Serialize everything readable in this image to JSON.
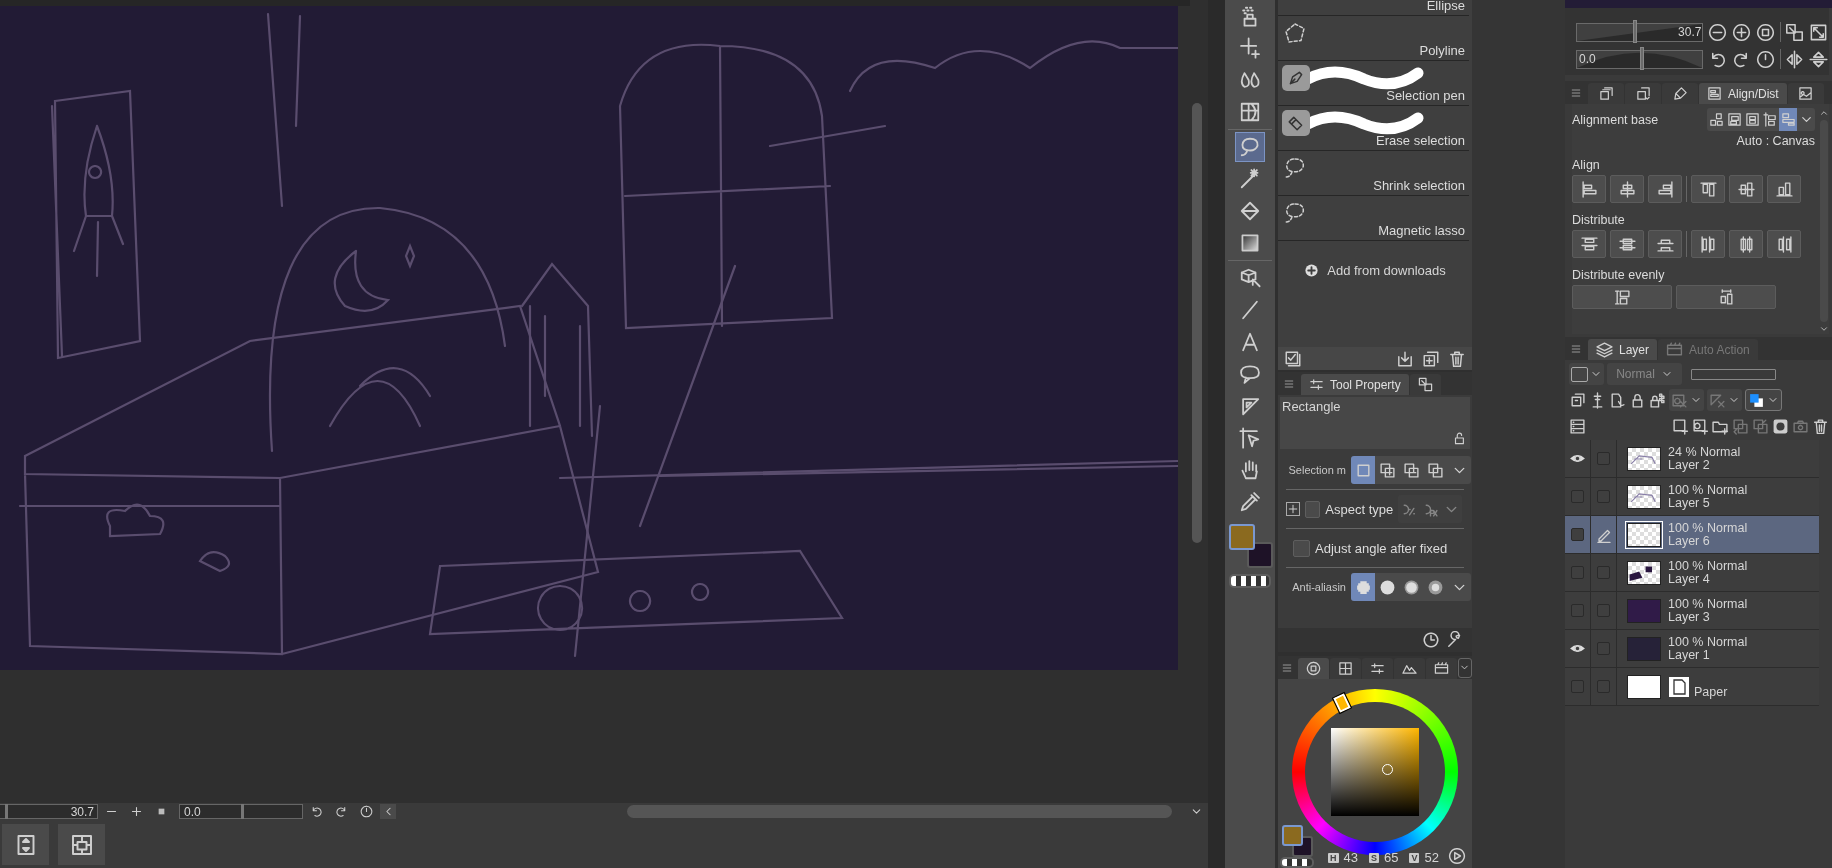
{
  "canvas": {
    "zoom_slider": {
      "value": "30.7",
      "level": 0.05
    },
    "rotation_slider": {
      "value": "0.0",
      "level": 0.5
    }
  },
  "tools": [
    {
      "selected": false
    },
    {
      "selected": false
    },
    {
      "selected": false
    },
    {
      "selected": false
    },
    {
      "selected": true
    },
    {
      "selected": false
    },
    {
      "selected": false
    },
    {
      "selected": false
    },
    {
      "selected": false
    },
    {
      "selected": false
    },
    {
      "selected": false
    },
    {
      "selected": false
    },
    {
      "selected": false
    },
    {
      "selected": false
    },
    {
      "selected": false
    },
    {
      "selected": false
    }
  ],
  "color_swatches": [
    {
      "color": "#8b6a1f",
      "selected": true
    },
    {
      "color": "#1e1227",
      "selected": false
    }
  ],
  "subtools": {
    "items": [
      {
        "name": "Ellipse",
        "kind": "ellipse",
        "selected": false
      },
      {
        "name": "Polyline",
        "kind": "polyline",
        "selected": false
      },
      {
        "name": "Selection pen",
        "kind": "pen",
        "selected": false
      },
      {
        "name": "Erase selection",
        "kind": "eraser",
        "selected": false
      },
      {
        "name": "Shrink selection",
        "kind": "lasso",
        "selected": false
      },
      {
        "name": "Magnetic lasso",
        "kind": "lasso",
        "selected": false
      }
    ],
    "add_button": "Add from downloads"
  },
  "tool_property": {
    "tab": "Tool Property",
    "subtool": "Rectangle",
    "rows": [
      {
        "kind": "segmented",
        "label": "Selection m",
        "options": [
          {
            "selected": true
          },
          {
            "selected": false
          },
          {
            "selected": false
          },
          {
            "selected": false
          }
        ]
      },
      {
        "kind": "checkbox",
        "label": "Aspect type",
        "checked": false,
        "expanded": false
      },
      {
        "kind": "checkbox",
        "label": "Adjust angle after fixed",
        "checked": false
      },
      {
        "kind": "segmented",
        "label": "Anti-aliasin",
        "options": [
          {
            "selected": true
          },
          {
            "selected": false
          },
          {
            "selected": false
          },
          {
            "selected": false
          }
        ]
      }
    ]
  },
  "color_panel": {
    "tabs": [
      {
        "selected": true
      },
      {
        "selected": false
      },
      {
        "selected": false
      },
      {
        "selected": false
      },
      {
        "selected": false
      }
    ],
    "swatches": [
      {
        "color": "#8b6a1f",
        "selected": true
      },
      {
        "color": "#1e1227",
        "selected": false
      }
    ],
    "hsv": [
      {
        "key": "H",
        "value": "43"
      },
      {
        "key": "S",
        "value": "65"
      },
      {
        "key": "V",
        "value": "52"
      }
    ]
  },
  "navigator": {
    "zoom_slider": {
      "value": "30.7",
      "level": 0.45
    },
    "rotation_slider": {
      "value": "0.0",
      "level": 0.5
    }
  },
  "align_panel": {
    "tabs": [
      {
        "selected": false
      },
      {
        "selected": false
      },
      {
        "selected": false
      },
      {
        "label": "Align/Dist",
        "selected": true
      },
      {
        "selected": false
      }
    ],
    "alignment_base": {
      "label": "Alignment base",
      "options": [
        {
          "selected": false
        },
        {
          "selected": false
        },
        {
          "selected": false
        },
        {
          "selected": false
        },
        {
          "selected": true
        }
      ],
      "note": "Auto : Canvas"
    },
    "align_label": "Align",
    "distribute_label": "Distribute",
    "distribute_evenly_label": "Distribute evenly"
  },
  "layer_panel": {
    "tabs": [
      {
        "label": "Layer",
        "selected": true
      },
      {
        "label": "Auto Action",
        "selected": false
      }
    ],
    "blend_mode": "Normal",
    "opacity_slider": {
      "level": 0
    },
    "layers": [
      {
        "kind": "raster",
        "mode": "24 % Normal",
        "name": "Layer 2",
        "visible": true,
        "editing": false,
        "selected": false,
        "thumbnail": {
          "kind": "sketch"
        }
      },
      {
        "kind": "raster",
        "mode": "100 % Normal",
        "name": "Layer 5",
        "visible": false,
        "editing": false,
        "selected": false,
        "thumbnail": {
          "kind": "sketch"
        }
      },
      {
        "kind": "raster",
        "mode": "100 % Normal",
        "name": "Layer 6",
        "visible": false,
        "editing": true,
        "selected": true,
        "thumbnail": {
          "kind": "empty"
        }
      },
      {
        "kind": "raster",
        "mode": "100 % Normal",
        "name": "Layer 4",
        "visible": false,
        "editing": false,
        "selected": false,
        "thumbnail": {
          "kind": "shapes"
        }
      },
      {
        "kind": "raster",
        "mode": "100 % Normal",
        "name": "Layer 3",
        "visible": false,
        "editing": false,
        "selected": false,
        "thumbnail": {
          "kind": "purple"
        }
      },
      {
        "kind": "raster",
        "mode": "100 % Normal",
        "name": "Layer 1",
        "visible": true,
        "editing": false,
        "selected": false,
        "thumbnail": {
          "kind": "navy"
        }
      },
      {
        "kind": "paper",
        "name": "Paper",
        "visible": false,
        "editing": false,
        "selected": false,
        "thumbnail": {
          "kind": "white"
        }
      }
    ]
  }
}
